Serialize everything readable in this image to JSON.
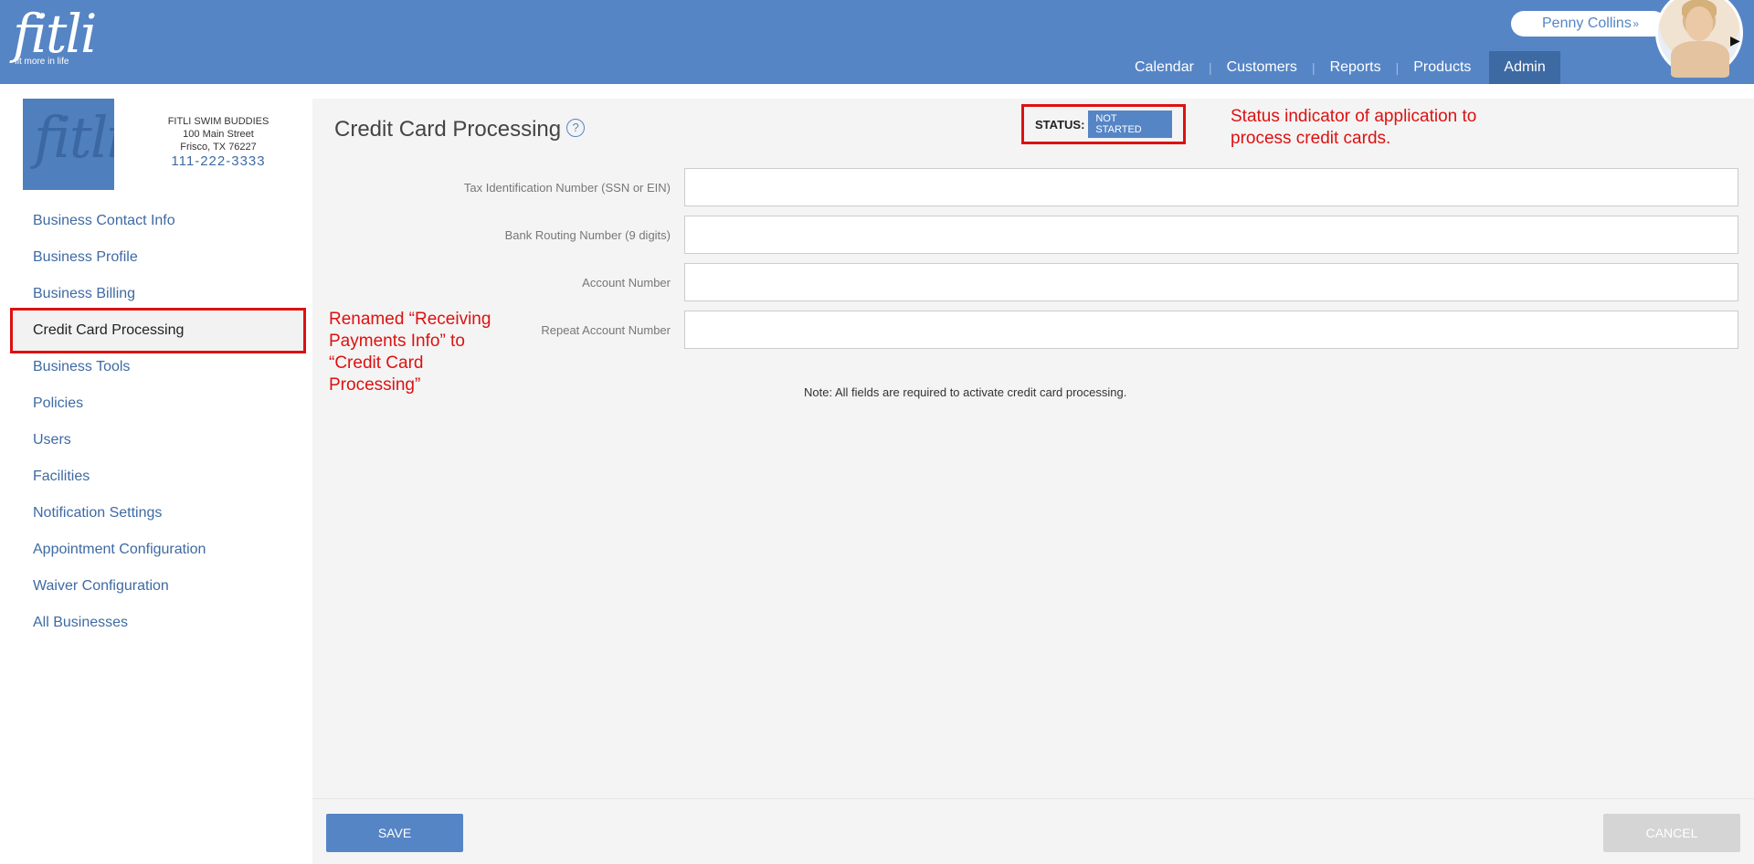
{
  "header": {
    "brand": "fitli",
    "tagline": "fit more in life",
    "user_name": "Penny Collins",
    "nav": [
      {
        "label": "Calendar"
      },
      {
        "label": "Customers"
      },
      {
        "label": "Reports"
      },
      {
        "label": "Products"
      },
      {
        "label": "Admin"
      }
    ]
  },
  "business": {
    "name": "FITLI SWIM BUDDIES",
    "address1": "100 Main Street",
    "address2": "Frisco, TX 76227",
    "phone": "111-222-3333"
  },
  "sidebar": {
    "items": [
      {
        "label": "Business Contact Info"
      },
      {
        "label": "Business Profile"
      },
      {
        "label": "Business Billing"
      },
      {
        "label": "Credit Card Processing"
      },
      {
        "label": "Business Tools"
      },
      {
        "label": "Policies"
      },
      {
        "label": "Users"
      },
      {
        "label": "Facilities"
      },
      {
        "label": "Notification Settings"
      },
      {
        "label": "Appointment Configuration"
      },
      {
        "label": "Waiver Configuration"
      },
      {
        "label": "All Businesses"
      }
    ]
  },
  "main": {
    "title": "Credit Card Processing",
    "status_label": "STATUS:",
    "status_value": "NOT STARTED",
    "fields": [
      {
        "label": "Tax Identification Number (SSN or EIN)",
        "value": ""
      },
      {
        "label": "Bank Routing Number (9 digits)",
        "value": ""
      },
      {
        "label": "Account Number",
        "value": ""
      },
      {
        "label": "Repeat Account Number",
        "value": ""
      }
    ],
    "note": "Note: All fields are required to activate credit card processing."
  },
  "annotations": {
    "status": "Status indicator of application to process credit cards.",
    "renamed": "Renamed “Receiving Payments Info” to “Credit Card Processing”"
  },
  "footer": {
    "save_label": "SAVE",
    "cancel_label": "CANCEL"
  },
  "colors": {
    "brand": "#5585c5",
    "nav_active": "#3e6aa3",
    "annotation": "#dd1111"
  }
}
